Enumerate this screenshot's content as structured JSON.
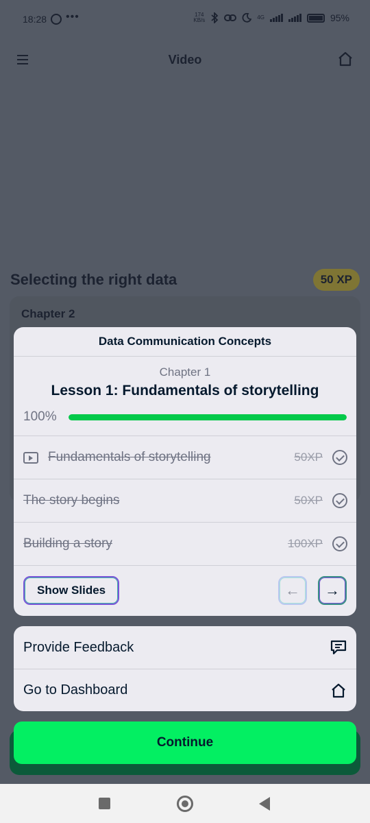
{
  "status_bar": {
    "time": "18:28",
    "more_dots": "•••",
    "speed_value": "174",
    "speed_unit": "KB/s",
    "network": "4G",
    "battery": "95%"
  },
  "header": {
    "title": "Video",
    "menu_icon": "hamburger-menu-icon",
    "home_icon": "home-icon"
  },
  "lesson": {
    "title": "Selecting the right data",
    "xp": "50 XP"
  },
  "chapter_card": {
    "label": "Chapter 2"
  },
  "modal": {
    "title": "Data Communication Concepts",
    "chapter": "Chapter 1",
    "lesson_heading": "Lesson 1: Fundamentals of storytelling",
    "progress_label": "100%",
    "progress_value": 1.0,
    "items": [
      {
        "title": "Fundamentals of storytelling",
        "xp": "50XP",
        "icon": "video-icon",
        "completed": true
      },
      {
        "title": "The story begins",
        "xp": "50XP",
        "completed": true
      },
      {
        "title": "Building a story",
        "xp": "100XP",
        "completed": true
      }
    ],
    "show_slides_label": "Show Slides",
    "prev_arrow": "←",
    "next_arrow": "→"
  },
  "actions": {
    "feedback_label": "Provide Feedback",
    "feedback_icon": "feedback-icon",
    "dashboard_label": "Go to Dashboard",
    "dashboard_icon": "home-icon"
  },
  "continue_label": "Continue",
  "colors": {
    "accent_green": "#03ef62",
    "progress_green": "#03c94a",
    "navy_text": "#05192d",
    "xp_badge": "#7f7534"
  }
}
